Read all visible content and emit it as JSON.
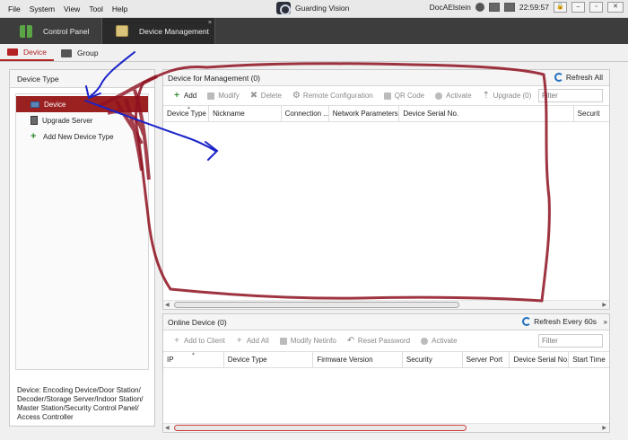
{
  "menubar": {
    "items": [
      "File",
      "System",
      "View",
      "Tool",
      "Help"
    ],
    "app_title": "Guarding Vision",
    "user": "DocAElstein",
    "clock": "22:59:57",
    "window_buttons": [
      "–",
      "▫",
      "✕"
    ]
  },
  "tabs": {
    "control_panel": "Control Panel",
    "device_management": "Device Management",
    "close_glyph": "×"
  },
  "subtabs": {
    "device": "Device",
    "group": "Group"
  },
  "left_panel": {
    "title": "Device Type",
    "items": [
      {
        "label": "Device",
        "icon": "device-icon"
      },
      {
        "label": "Upgrade Server",
        "icon": "server-icon"
      },
      {
        "label": "Add New Device Type",
        "icon": "add-icon"
      }
    ],
    "note": "Device: Encoding Device/Door Station/ Decoder/Storage Server/Indoor Station/ Master Station/Security Control Panel/ Access Controller"
  },
  "management": {
    "title": "Device for Management (0)",
    "refresh": "Refresh All",
    "toolbar": [
      "Add",
      "Modify",
      "Delete",
      "Remote Configuration",
      "QR Code",
      "Activate",
      "Upgrade (0)"
    ],
    "filter_placeholder": "Filter",
    "columns": [
      "Device Type",
      "Nickname",
      "Connection ...",
      "Network Parameters",
      "Device Serial No.",
      "Securit"
    ]
  },
  "online": {
    "title": "Online Device (0)",
    "refresh": "Refresh Every 60s",
    "toolbar": [
      "Add to Client",
      "Add All",
      "Modify Netinfo",
      "Reset Password",
      "Activate"
    ],
    "filter_placeholder": "Filter",
    "columns": [
      "IP",
      "Device Type",
      "Firmware Version",
      "Security",
      "Server Port",
      "Device Serial No.",
      "Start Time"
    ]
  },
  "colors": {
    "accent": "#b42323",
    "selected_row": "#9b2020",
    "annotation_red": "#8e1020",
    "annotation_blue": "#1a23c8"
  }
}
